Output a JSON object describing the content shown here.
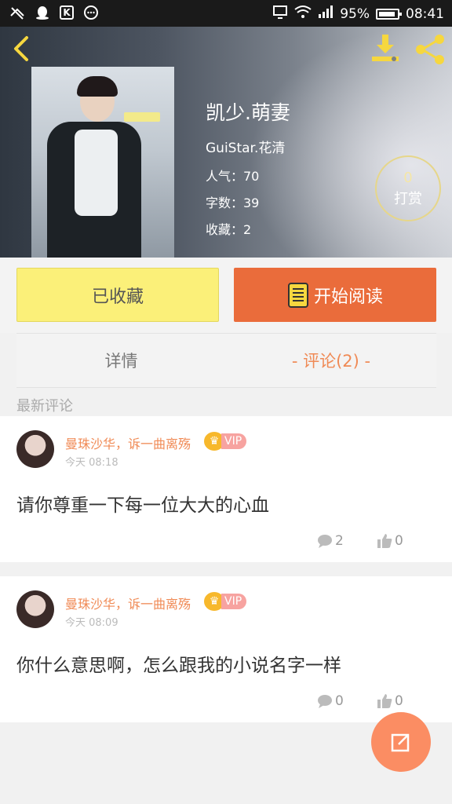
{
  "status_bar": {
    "battery": "95%",
    "time": "08:41"
  },
  "book": {
    "title": "凯少.萌妻",
    "author": "GuiStar.花清",
    "popularity": "人气：70",
    "word_count": "字数：39",
    "collections": "收藏：2"
  },
  "reward": {
    "count": "0",
    "label": "打赏"
  },
  "actions": {
    "collect_label": "已收藏",
    "read_label": "开始阅读"
  },
  "tabs": {
    "detail": "详情",
    "comments": "- 评论(2) -"
  },
  "section_title": "最新评论",
  "comments": [
    {
      "user": "曼珠沙华，诉一曲离殇",
      "vip": "VIP",
      "time": "今天 08:18",
      "text": "请你尊重一下每一位大大的心血",
      "replies": "2",
      "likes": "0"
    },
    {
      "user": "曼珠沙华，诉一曲离殇",
      "vip": "VIP",
      "time": "今天 08:09",
      "text": "你什么意思啊，怎么跟我的小说名字一样",
      "replies": "0",
      "likes": "0"
    }
  ],
  "colors": {
    "accent": "#f08a55",
    "collect_bg": "#fbf079",
    "read_bg": "#ea6c3b",
    "fab_bg": "#fb8d63",
    "icon_yellow": "#f6d73f"
  },
  "icons": [
    "wifi-off-icon",
    "qq-icon",
    "k-app-icon",
    "chat-icon",
    "cast-icon",
    "wifi-icon",
    "signal-icon",
    "battery-icon",
    "back-arrow-icon",
    "download-icon",
    "share-icon",
    "book-icon",
    "comment-bubble-icon",
    "thumbs-up-icon",
    "edit-icon",
    "crown-icon"
  ]
}
